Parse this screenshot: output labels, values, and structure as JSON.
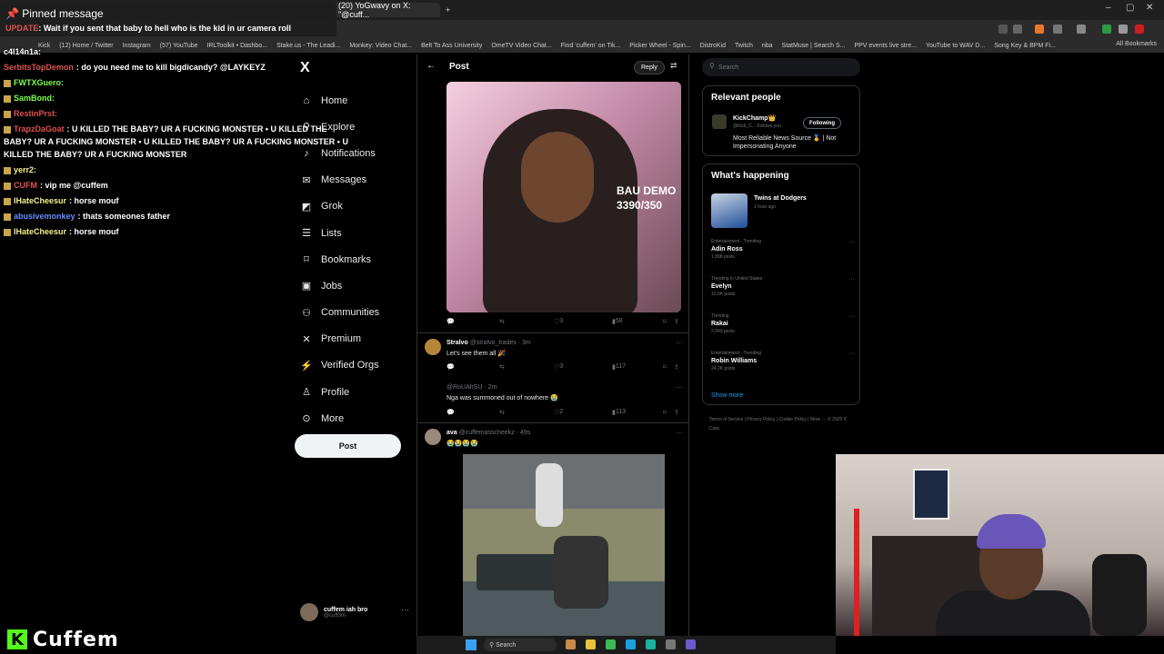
{
  "browser": {
    "tabs": [
      "(20) YoGwavy on X: \"@cuff...",
      "+"
    ],
    "window_controls": [
      "–",
      "▢",
      "✕"
    ],
    "bookmarks": [
      "Kick",
      "(12) Home / Twitter",
      "Instagram",
      "(57) YouTube",
      "IRLToolkit • Dashbo...",
      "Stake.us - The Leadi...",
      "Monkey: Video Chat...",
      "Belt To Ass University",
      "OmeTV Video Chat...",
      "Find 'cuffem' on Tik...",
      "Picker Wheel - Spin...",
      "DistroKid",
      "Twitch",
      "nba",
      "StatMuse | Search S...",
      "PPV events live stre...",
      "YouTube to WAV D...",
      "Song Key & BPM Fi..."
    ],
    "all_bookmarks": "All Bookmarks"
  },
  "pinned": {
    "title": "Pinned message",
    "user": "UPDATE",
    "text": ": Wait if you sent that baby to hell who is the kid in ur camera roll"
  },
  "chat": [
    {
      "user": "c4l14n1a:",
      "msg": "",
      "color": "#ffffff"
    },
    {
      "user": "SerbitsTopDemon",
      "msg": ": do you need me to kill bigdicandy? @LAYKEYZ",
      "color": "#e05252"
    },
    {
      "user": "FWTXGuero:",
      "msg": "",
      "color": "#7cff4a"
    },
    {
      "user": "SamBond:",
      "msg": "",
      "color": "#7cff4a"
    },
    {
      "user": "RestinPrst:",
      "msg": "",
      "color": "#e05252"
    },
    {
      "user": "TrapzDaGoat",
      "msg": ": U KILLED THE BABY? UR A FUCKING MONSTER • U KILLED THE BABY? UR A FUCKING MONSTER • U KILLED THE BABY? UR A FUCKING MONSTER • U KILLED THE BABY? UR A FUCKING MONSTER",
      "color": "#e05252"
    },
    {
      "user": "yerr2:",
      "msg": "",
      "color": "#f5f089"
    },
    {
      "user": "CUFM",
      "msg": ": vip me @cuffem",
      "color": "#e05252"
    },
    {
      "user": "IHateCheesur",
      "msg": ": horse mouf",
      "color": "#f5f089"
    },
    {
      "user": "abusivemonkey",
      "msg": ": thats someones father",
      "color": "#6a8cff"
    },
    {
      "user": "IHateCheesur",
      "msg": ": horse mouf",
      "color": "#f5f089"
    }
  ],
  "x_nav": {
    "logo": "X",
    "items": [
      {
        "label": "Home",
        "icon": "⌂"
      },
      {
        "label": "Explore",
        "icon": "⚲"
      },
      {
        "label": "Notifications",
        "icon": "♪"
      },
      {
        "label": "Messages",
        "icon": "✉"
      },
      {
        "label": "Grok",
        "icon": "◩"
      },
      {
        "label": "Lists",
        "icon": "☰"
      },
      {
        "label": "Bookmarks",
        "icon": "⌑"
      },
      {
        "label": "Jobs",
        "icon": "▣"
      },
      {
        "label": "Communities",
        "icon": "⚇"
      },
      {
        "label": "Premium",
        "icon": "✕"
      },
      {
        "label": "Verified Orgs",
        "icon": "⚡"
      },
      {
        "label": "Profile",
        "icon": "♙"
      },
      {
        "label": "More",
        "icon": "⊙"
      }
    ],
    "post_button": "Post",
    "account_name": "cuffem iah bro",
    "account_handle": "@cuff3m"
  },
  "main": {
    "title": "Post",
    "reply_button": "Reply",
    "video_overlay_line1": "BAU DEMO",
    "video_overlay_line2": "3390/350",
    "post_actions": {
      "likes": "3",
      "views": "58"
    },
    "replies": [
      {
        "name": "Stralvo",
        "handle": "@stralvo_trades · 3m",
        "text": "Let's see them all 🎉",
        "likes": "3",
        "views": "117"
      },
      {
        "name": "",
        "handle": "@RoUAhSU · 2m",
        "text": "Nga was summoned out of nowhere 😭",
        "likes": "2",
        "views": "113"
      },
      {
        "name": "ava",
        "handle": "@cuffemasscheekz · 49s",
        "text": "😭😭😭😭",
        "likes": "",
        "views": ""
      }
    ]
  },
  "right": {
    "search_placeholder": "Search",
    "relevant_title": "Relevant people",
    "person_name": "KickChamp👑",
    "person_handle": "@Kick_C... Follows you",
    "follow_label": "Following",
    "person_bio": "Most Reliable News Source 🏅 | Not Impersonating Anyone",
    "happening_title": "What's happening",
    "event_title": "Twins at Dodgers",
    "event_time": "1 hour ago",
    "trends": [
      {
        "context": "Entertainment · Trending",
        "title": "Adin Ross",
        "posts": "1,898 posts"
      },
      {
        "context": "Trending in United States",
        "title": "Evelyn",
        "posts": "10.6K posts"
      },
      {
        "context": "Trending",
        "title": "Rakai",
        "posts": "2,643 posts"
      },
      {
        "context": "Entertainment · Trending",
        "title": "Robin Williams",
        "posts": "24.2K posts"
      }
    ],
    "show_more": "Show more",
    "footer": "Terms of Service | Privacy Policy | Cookie Policy | More ··· © 2025 X Corp."
  },
  "kick": {
    "logo_letter": "K",
    "name": "Cuffem"
  },
  "taskbar": {
    "search": "Search"
  }
}
